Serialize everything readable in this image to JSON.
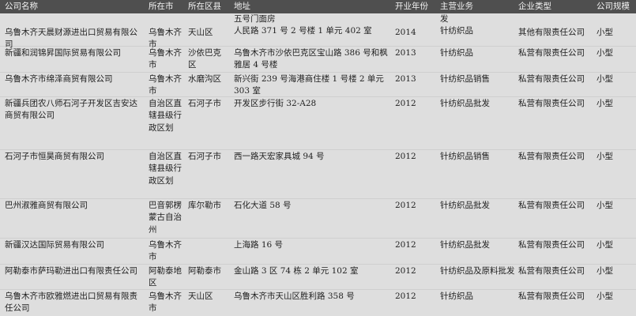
{
  "headers": {
    "name": "公司名称",
    "city": "所在市",
    "district": "所在区县",
    "address": "地址",
    "year": "开业年份",
    "business": "主营业务",
    "type": "企业类型",
    "scale": "公司规模"
  },
  "rows": [
    {
      "name": "乌鲁木齐天晨财源进出口贸易有限公司",
      "city": "乌鲁木齐市",
      "district": "天山区",
      "address": "五号门面房\n人民路 371 号 2 号楼 1 单元 402 室",
      "year": "2014",
      "business": "发\n针纺织品",
      "type": "其他有限责任公司",
      "scale": "小型"
    },
    {
      "name": "新疆和润锦昇国际贸易有限公司",
      "city": "乌鲁木齐市",
      "district": "沙依巴克区",
      "address": "乌鲁木齐市沙依巴克区宝山路 386 号和枫雅居 4 号楼",
      "year": "2013",
      "business": "针纺织品",
      "type": "私营有限责任公司",
      "scale": "小型"
    },
    {
      "name": "乌鲁木齐市绵泽商贸有限公司",
      "city": "乌鲁木齐市",
      "district": "水磨沟区",
      "address": "新兴街 239 号海港商住楼 1 号楼 2 单元 303 室",
      "year": "2013",
      "business": "针纺织品销售",
      "type": "私营有限责任公司",
      "scale": "小型"
    },
    {
      "name": "新疆兵团农八师石河子开发区吉安达商贸有限公司",
      "city": "自治区直辖县级行政区划",
      "district": "石河子市",
      "address": "开发区步行街 32-A28",
      "year": "2012",
      "business": "针纺织品批发",
      "type": "私营有限责任公司",
      "scale": "小型"
    },
    {
      "name": "石河子市恒昊商贸有限公司",
      "city": "自治区直辖县级行政区划",
      "district": "石河子市",
      "address": "西一路天宏家具城 94 号",
      "year": "2012",
      "business": "针纺织品销售",
      "type": "私营有限责任公司",
      "scale": "小型"
    },
    {
      "name": "巴州淑雅商贸有限公司",
      "city": "巴音郭楞蒙古自治州",
      "district": "库尔勒市",
      "address": "石化大道 58 号",
      "year": "2012",
      "business": "针纺织品批发",
      "type": "私营有限责任公司",
      "scale": "小型"
    },
    {
      "name": "新疆汉达国际贸易有限公司",
      "city": "乌鲁木齐市",
      "district": "",
      "address": "上海路 16 号",
      "year": "2012",
      "business": "针纺织品批发",
      "type": "私营有限责任公司",
      "scale": "小型"
    },
    {
      "name": "阿勒泰市萨玛勒进出口有限责任公司",
      "city": "阿勒泰地区",
      "district": "阿勒泰市",
      "address": "金山路 3 区 74 栋 2 单元 102 室",
      "year": "2012",
      "business": "针纺织品及原料批发",
      "type": "私营有限责任公司",
      "scale": "小型"
    },
    {
      "name": "乌鲁木齐市欧雅燃进出口贸易有限责任公司",
      "city": "乌鲁木齐市",
      "district": "天山区",
      "address": "乌鲁木齐市天山区胜利路 358 号",
      "year": "2012",
      "business": "针纺织品",
      "type": "私营有限责任公司",
      "scale": "小型"
    }
  ]
}
